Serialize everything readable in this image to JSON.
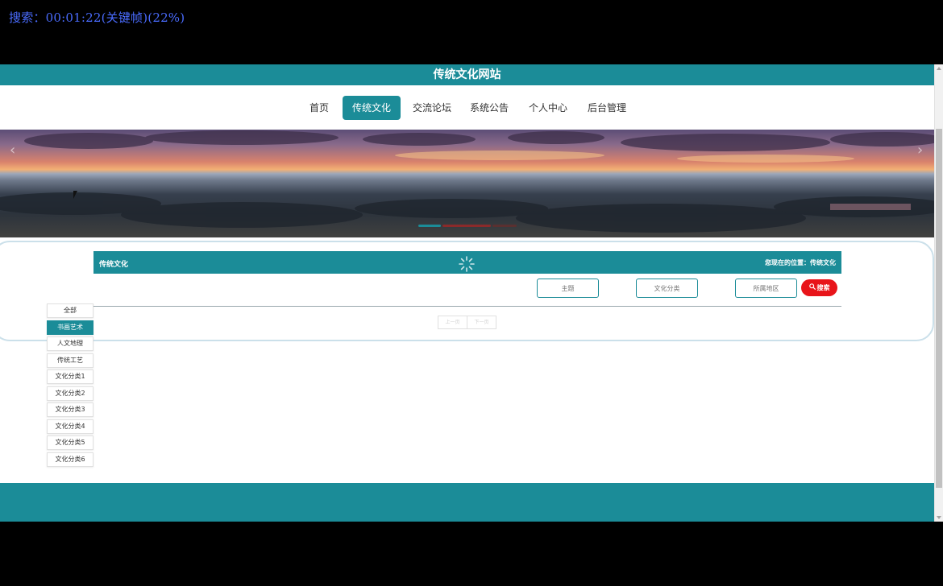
{
  "overlay": {
    "text": "搜索：00:01:22(关键帧)(22%)"
  },
  "header": {
    "title": "传统文化网站"
  },
  "nav": {
    "items": [
      "首页",
      "传统文化",
      "交流论坛",
      "系统公告",
      "个人中心",
      "后台管理"
    ],
    "active": "传统文化"
  },
  "banner": {
    "prev_icon": "‹",
    "next_icon": "›"
  },
  "section": {
    "title": "传统文化",
    "breadcrumb": "您现在的位置：传统文化"
  },
  "filters": {
    "topic_placeholder": "主题",
    "category_placeholder": "文化分类",
    "region_placeholder": "所属地区",
    "search_label": "搜索"
  },
  "pager": {
    "prev": "上一页",
    "next": "下一页"
  },
  "categories": {
    "items": [
      "全部",
      "书画艺术",
      "人文地理",
      "传统工艺",
      "文化分类1",
      "文化分类2",
      "文化分类3",
      "文化分类4",
      "文化分类5",
      "文化分类6"
    ],
    "active": "书画艺术"
  },
  "colors": {
    "accent": "#1b8c98",
    "search": "#e8141a",
    "overlay_text": "#4a6cff"
  }
}
